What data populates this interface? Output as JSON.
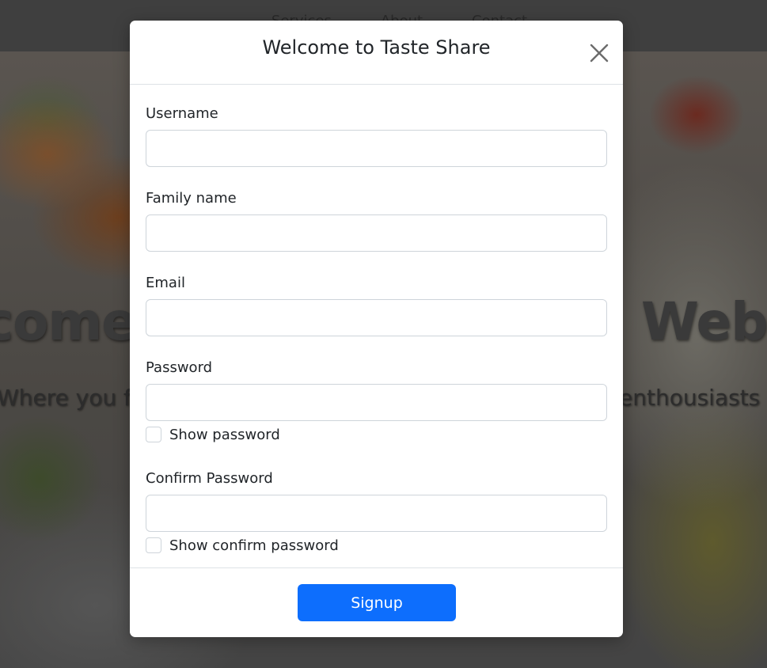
{
  "background": {
    "nav": [
      "Services",
      "About",
      "Contact"
    ],
    "heading_left": "come",
    "heading_right": "Webs",
    "subtitle_left": "Where you fir",
    "subtitle_right": "enthousiasts"
  },
  "modal": {
    "title": "Welcome to Taste Share",
    "close_icon": "close-icon",
    "fields": {
      "username": {
        "label": "Username",
        "value": "",
        "placeholder": ""
      },
      "family_name": {
        "label": "Family name",
        "value": "",
        "placeholder": ""
      },
      "email": {
        "label": "Email",
        "value": "",
        "placeholder": ""
      },
      "password": {
        "label": "Password",
        "value": "",
        "placeholder": "",
        "show_label": "Show password"
      },
      "confirm_password": {
        "label": "Confirm Password",
        "value": "",
        "placeholder": "",
        "show_label": "Show confirm password"
      }
    },
    "submit_label": "Signup"
  },
  "colors": {
    "primary": "#0d6efd",
    "text": "#212529",
    "border": "#ced4da",
    "divider": "#dee2e6"
  }
}
